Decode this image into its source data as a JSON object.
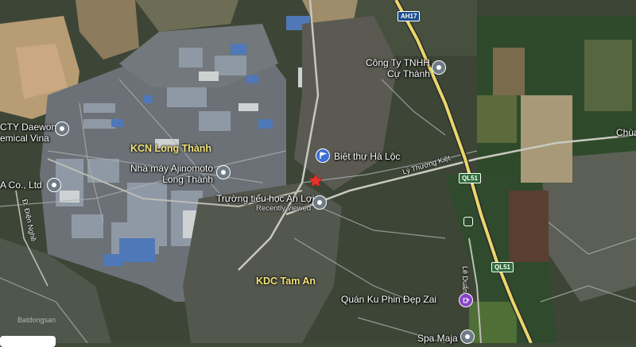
{
  "map": {
    "type": "satellite",
    "area_labels": {
      "kcn_long_thanh": "KCN Long Thành",
      "kdc_tam_an": "KDC Tam An"
    },
    "pois": {
      "daewon_line1": "CTY Daewon",
      "daewon_line2": "emical Vina",
      "co_ltd": "A Co., Ltd",
      "ajinomoto_line1": "Nhà máy Ajinomoto",
      "ajinomoto_line2": "Long Thành",
      "cu_thanh_line1": "Công Ty TNHH",
      "cu_thanh_line2": "Cự Thành",
      "biet_thu": "Biệt thự Hà Lộc",
      "truong": "Trường tiểu học An Lợi",
      "recently_viewed": "Recently viewed",
      "quan_ku": "Quán Ku Phin Đẹp Zai",
      "spa": "Spa Maja",
      "chua": "Chùa"
    },
    "roads": {
      "ly_thuong_kiet": "Lý Thường Kiệt",
      "le_duan": "Lê Duẩn",
      "d_dien_nghe": "Đ. Điện Nghề"
    },
    "shields": {
      "ah17": "AH17",
      "ql51_a": "QL51",
      "ql51_b": "QL51"
    },
    "watermark": "Batdongsan"
  }
}
